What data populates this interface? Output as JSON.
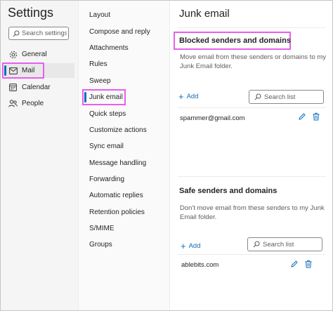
{
  "settings": {
    "title": "Settings",
    "search_placeholder": "Search settings",
    "nav": [
      {
        "label": "General",
        "icon": "gear-icon"
      },
      {
        "label": "Mail",
        "icon": "mail-icon"
      },
      {
        "label": "Calendar",
        "icon": "calendar-icon"
      },
      {
        "label": "People",
        "icon": "people-icon"
      }
    ]
  },
  "mail_nav": [
    "Layout",
    "Compose and reply",
    "Attachments",
    "Rules",
    "Sweep",
    "Junk email",
    "Quick steps",
    "Customize actions",
    "Sync email",
    "Message handling",
    "Forwarding",
    "Automatic replies",
    "Retention policies",
    "S/MIME",
    "Groups"
  ],
  "main": {
    "title": "Junk email",
    "blocked": {
      "title": "Blocked senders and domains",
      "description": "Move email from these senders or domains to my Junk Email folder.",
      "add_label": "Add",
      "search_placeholder": "Search list",
      "entries": [
        "spammer@gmail.com"
      ]
    },
    "safe": {
      "title": "Safe senders and domains",
      "description": "Don't move email from these senders to my Junk Email folder.",
      "add_label": "Add",
      "search_placeholder": "Search list",
      "entries": [
        "ablebits.com"
      ]
    }
  },
  "colors": {
    "accent": "#0f6cbd",
    "highlight": "#e85df0"
  }
}
